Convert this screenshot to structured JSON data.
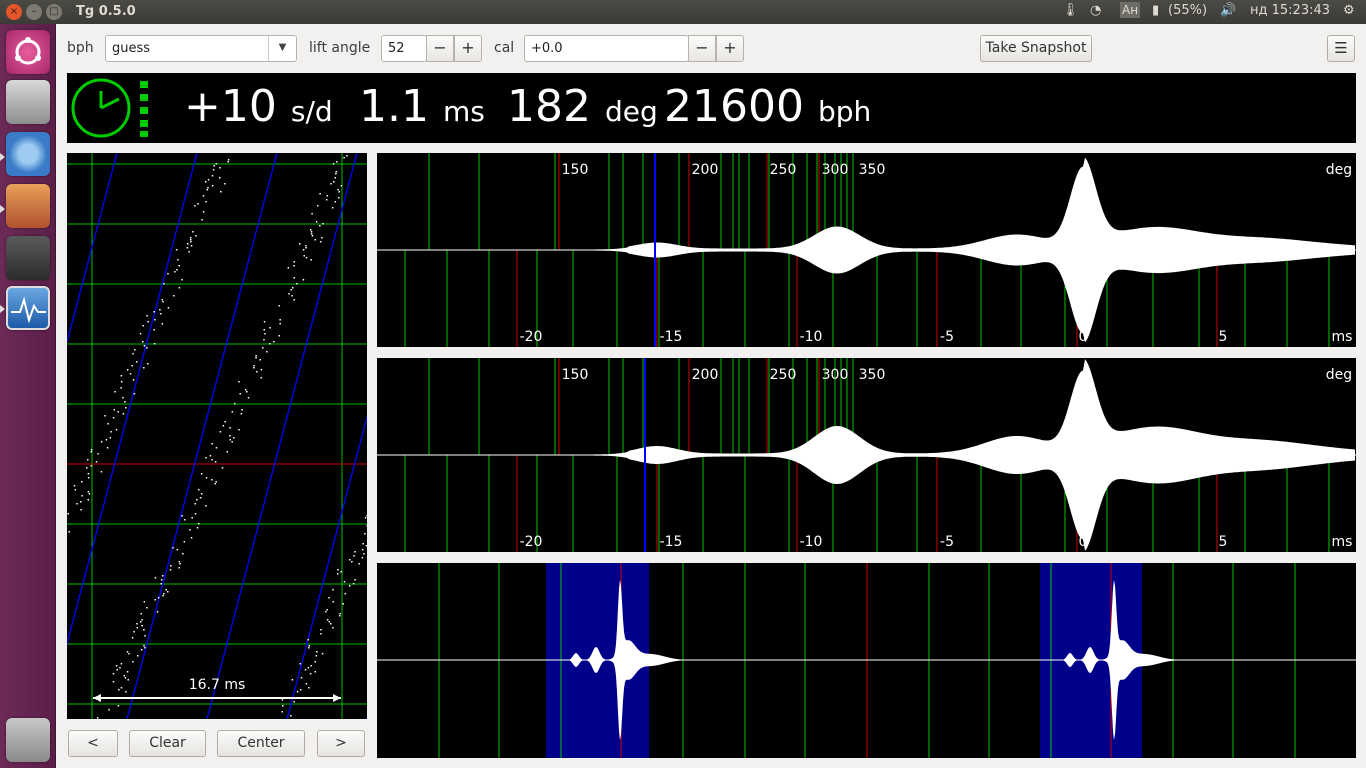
{
  "window": {
    "title": "Tg 0.5.0",
    "close": "×",
    "minimize": "–",
    "maximize": "□"
  },
  "tray": {
    "thermo": "🌡",
    "wifi": "◔",
    "keyboard": "Ан",
    "battery_icon": "▮",
    "battery": "(55%)",
    "volume": "🔊",
    "clock": "нд 15:23:43",
    "gear": "⚙"
  },
  "toolbar": {
    "bph_label": "bph",
    "bph_value": "guess",
    "lift_label": "lift angle",
    "lift_value": "52",
    "cal_label": "cal",
    "cal_value": "+0.0",
    "minus": "−",
    "plus": "+",
    "snapshot": "Take Snapshot",
    "menu": "☰"
  },
  "readout": {
    "rate": "+10",
    "rate_unit": "s/d",
    "beat_error": "1.1",
    "beat_error_unit": "ms",
    "amplitude": "182",
    "amplitude_unit": "deg",
    "bph": "21600",
    "bph_unit": "bph"
  },
  "paper": {
    "span_label": "16.7 ms"
  },
  "paper_buttons": {
    "prev": "<",
    "clear": "Clear",
    "center": "Center",
    "next": ">"
  },
  "waveform": {
    "deg_unit": "deg",
    "ms_unit": "ms",
    "deg_ticks": [
      "150",
      "200",
      "250",
      "300",
      "350"
    ],
    "ms_ticks": [
      "-20",
      "-15",
      "-10",
      "-5",
      "0",
      "5"
    ]
  },
  "colors": {
    "grid_green": "#00c000",
    "grid_red": "#d00000",
    "marker_blue": "#0000ff",
    "highlight": "#00008b",
    "status_green": "#00cc00"
  }
}
